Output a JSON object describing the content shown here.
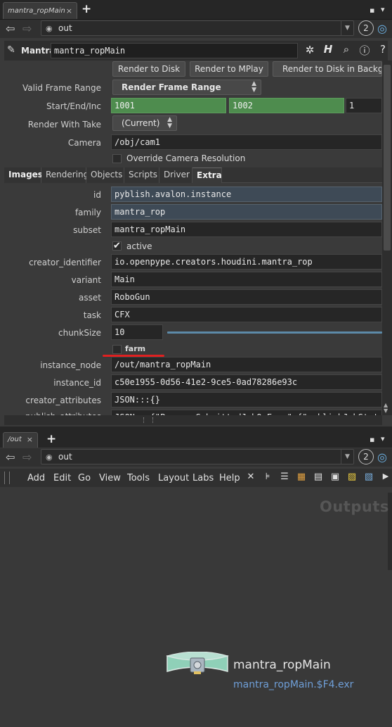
{
  "top_pane": {
    "tab_title": "mantra_ropMain",
    "tab_close": "×",
    "new_tab": "+",
    "path": "out",
    "pin_number": "2"
  },
  "node": {
    "type_label": "Mantra",
    "name": "mantra_ropMain"
  },
  "render_buttons": [
    "Render to Disk",
    "Render to MPlay",
    "Render to Disk in Background"
  ],
  "params": {
    "valid_frame_range": {
      "label": "Valid Frame Range",
      "value": "Render Frame Range"
    },
    "start_end_inc": {
      "label": "Start/End/Inc",
      "start": "1001",
      "end": "1002",
      "inc": "1"
    },
    "render_with_take": {
      "label": "Render With Take",
      "value": "(Current)"
    },
    "camera": {
      "label": "Camera",
      "value": "/obj/cam1"
    },
    "override_res": {
      "label": "Override Camera Resolution"
    }
  },
  "param_tabs": [
    "Images",
    "Rendering",
    "Objects",
    "Scripts",
    "Driver",
    "Extra"
  ],
  "extra": {
    "id": {
      "label": "id",
      "value": "pyblish.avalon.instance"
    },
    "family": {
      "label": "family",
      "value": "mantra_rop"
    },
    "subset": {
      "label": "subset",
      "value": "mantra_ropMain"
    },
    "active": {
      "label": "active",
      "check": "✔"
    },
    "creator_identifier": {
      "label": "creator_identifier",
      "value": "io.openpype.creators.houdini.mantra_rop"
    },
    "variant": {
      "label": "variant",
      "value": "Main"
    },
    "asset": {
      "label": "asset",
      "value": "RoboGun"
    },
    "task": {
      "label": "task",
      "value": "CFX"
    },
    "chunk_size": {
      "label": "chunkSize",
      "value": "10"
    },
    "farm": {
      "label": "farm"
    },
    "instance_node": {
      "label": "instance_node",
      "value": "/out/mantra_ropMain"
    },
    "instance_id": {
      "label": "instance_id",
      "value": "c50e1955-0d56-41e2-9ce5-0ad78286e93c"
    },
    "creator_attributes": {
      "label": "creator_attributes",
      "value": "JSON:::{}"
    },
    "publish_attributes": {
      "label": "publish_attributes",
      "value": "JSON:::{\"ProcessSubmittedJobOnFarm\":{\"publishJobState\":"
    }
  },
  "bottom_pane": {
    "tab_title": "/out",
    "tab_close": "×",
    "new_tab": "+",
    "path": "out",
    "pin_number": "2",
    "menu": [
      "Add",
      "Edit",
      "Go",
      "View",
      "Tools",
      "Layout",
      "Labs",
      "Help"
    ],
    "network_label": "Outputs",
    "node_name": "mantra_ropMain",
    "node_output": "mantra_ropMain.$F4.exr"
  },
  "colors": {
    "green_field": "#4e8c4e",
    "slate_field": "#3e4a56",
    "highlight_underline": "#e02020",
    "output_link": "#6f9fd8",
    "node_teal": "#8fd0b8"
  }
}
